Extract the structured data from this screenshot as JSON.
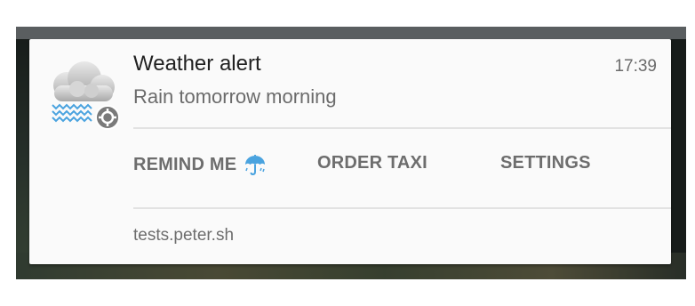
{
  "notification": {
    "title": "Weather alert",
    "time": "17:39",
    "message": "Rain tomorrow morning",
    "app_icon": "rain-cloud-icon",
    "badge_icon": "gear-icon",
    "actions": [
      {
        "label": "REMIND ME",
        "icon": "umbrella-icon"
      },
      {
        "label": "ORDER TAXI"
      },
      {
        "label": "SETTINGS"
      }
    ],
    "source": "tests.peter.sh"
  },
  "colors": {
    "card": "#fafafa",
    "title": "#212121",
    "secondary_text": "#6b6b6b",
    "umbrella": "#4aa3df",
    "rain": "#4aa3df"
  }
}
